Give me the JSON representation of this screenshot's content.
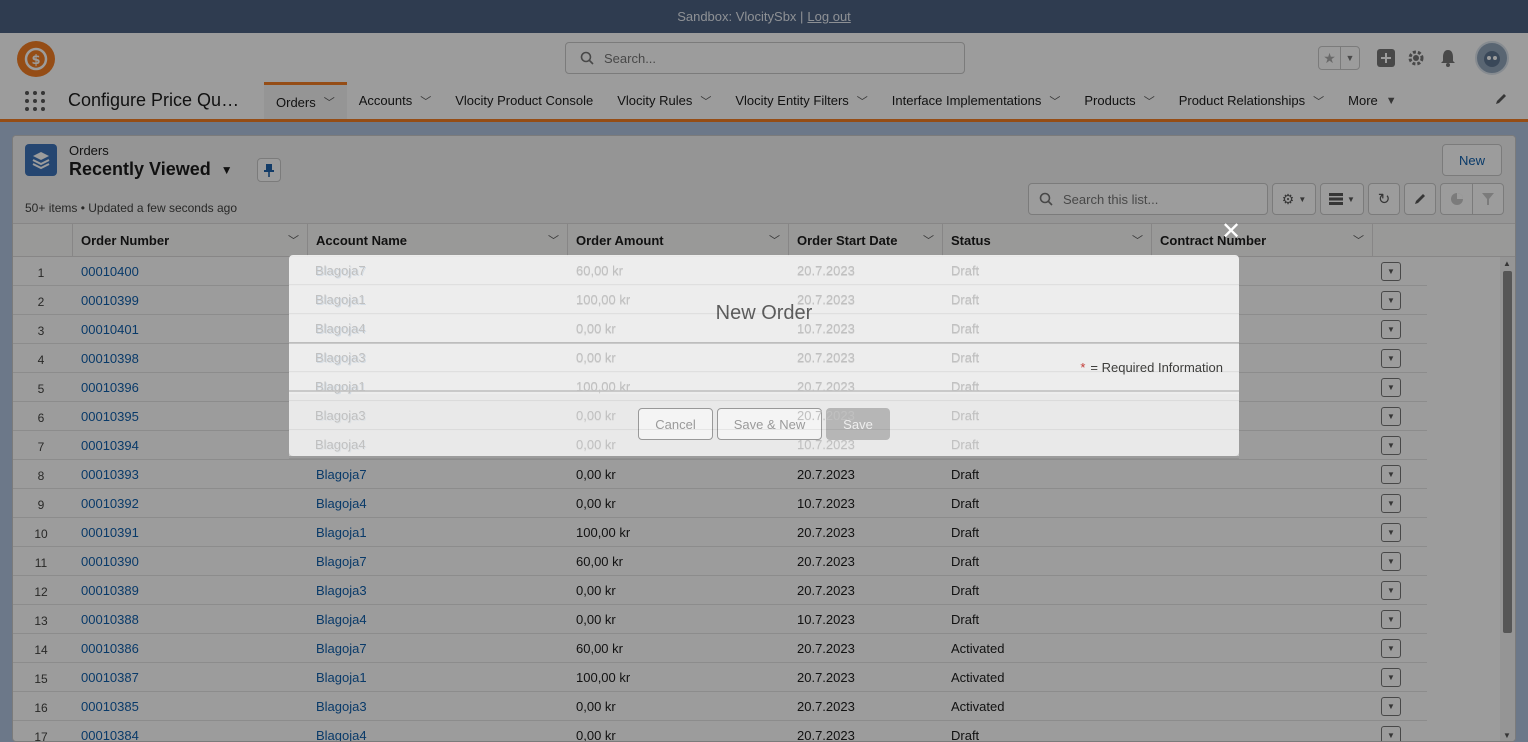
{
  "sandbox": {
    "label": "Sandbox: VlocitySbx |",
    "logout": "Log out"
  },
  "header": {
    "search_placeholder": "Search..."
  },
  "app": {
    "name": "Configure Price Qu…",
    "nav": [
      "Orders",
      "Accounts",
      "Vlocity Product Console",
      "Vlocity Rules",
      "Vlocity Entity Filters",
      "Interface Implementations",
      "Products",
      "Product Relationships",
      "More"
    ],
    "nav_has_chevron": [
      true,
      true,
      false,
      true,
      true,
      true,
      true,
      true,
      true
    ]
  },
  "list": {
    "object_label": "Orders",
    "view_name": "Recently Viewed",
    "meta": "50+ items • Updated a few seconds ago",
    "new_button": "New",
    "search_placeholder": "Search this list...",
    "columns": [
      "Order Number",
      "Account Name",
      "Order Amount",
      "Order Start Date",
      "Status",
      "Contract Number"
    ],
    "rows": [
      {
        "n": "1",
        "order": "00010400",
        "account": "Blagoja7",
        "amount": "60,00 kr",
        "date": "20.7.2023",
        "status": "Draft"
      },
      {
        "n": "2",
        "order": "00010399",
        "account": "Blagoja1",
        "amount": "100,00 kr",
        "date": "20.7.2023",
        "status": "Draft"
      },
      {
        "n": "3",
        "order": "00010401",
        "account": "Blagoja4",
        "amount": "0,00 kr",
        "date": "10.7.2023",
        "status": "Draft"
      },
      {
        "n": "4",
        "order": "00010398",
        "account": "Blagoja3",
        "amount": "0,00 kr",
        "date": "20.7.2023",
        "status": "Draft"
      },
      {
        "n": "5",
        "order": "00010396",
        "account": "Blagoja1",
        "amount": "100,00 kr",
        "date": "20.7.2023",
        "status": "Draft"
      },
      {
        "n": "6",
        "order": "00010395",
        "account": "Blagoja3",
        "amount": "0,00 kr",
        "date": "20.7.2023",
        "status": "Draft"
      },
      {
        "n": "7",
        "order": "00010394",
        "account": "Blagoja4",
        "amount": "0,00 kr",
        "date": "10.7.2023",
        "status": "Draft"
      },
      {
        "n": "8",
        "order": "00010393",
        "account": "Blagoja7",
        "amount": "0,00 kr",
        "date": "20.7.2023",
        "status": "Draft"
      },
      {
        "n": "9",
        "order": "00010392",
        "account": "Blagoja4",
        "amount": "0,00 kr",
        "date": "10.7.2023",
        "status": "Draft"
      },
      {
        "n": "10",
        "order": "00010391",
        "account": "Blagoja1",
        "amount": "100,00 kr",
        "date": "20.7.2023",
        "status": "Draft"
      },
      {
        "n": "11",
        "order": "00010390",
        "account": "Blagoja7",
        "amount": "60,00 kr",
        "date": "20.7.2023",
        "status": "Draft"
      },
      {
        "n": "12",
        "order": "00010389",
        "account": "Blagoja3",
        "amount": "0,00 kr",
        "date": "20.7.2023",
        "status": "Draft"
      },
      {
        "n": "13",
        "order": "00010388",
        "account": "Blagoja4",
        "amount": "0,00 kr",
        "date": "10.7.2023",
        "status": "Draft"
      },
      {
        "n": "14",
        "order": "00010386",
        "account": "Blagoja7",
        "amount": "60,00 kr",
        "date": "20.7.2023",
        "status": "Activated"
      },
      {
        "n": "15",
        "order": "00010387",
        "account": "Blagoja1",
        "amount": "100,00 kr",
        "date": "20.7.2023",
        "status": "Activated"
      },
      {
        "n": "16",
        "order": "00010385",
        "account": "Blagoja3",
        "amount": "0,00 kr",
        "date": "20.7.2023",
        "status": "Activated"
      },
      {
        "n": "17",
        "order": "00010384",
        "account": "Blagoja4",
        "amount": "0,00 kr",
        "date": "20.7.2023",
        "status": "Draft"
      }
    ]
  },
  "modal": {
    "title": "New Order",
    "required_star": "*",
    "required_note": "= Required Information",
    "cancel": "Cancel",
    "save_new": "Save & New",
    "save": "Save",
    "close_symbol": "✕"
  }
}
